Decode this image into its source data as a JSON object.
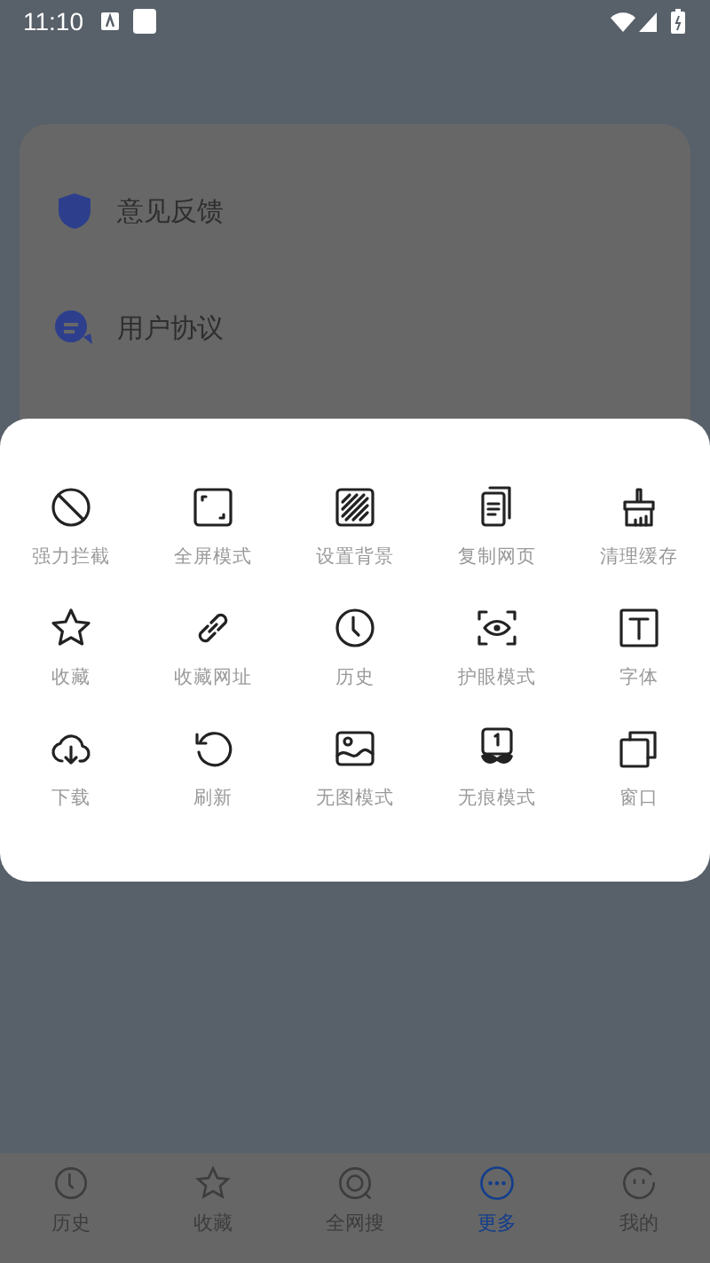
{
  "status_bar": {
    "time": "11:10"
  },
  "menu": [
    {
      "label": "意见反馈"
    },
    {
      "label": "用户协议"
    }
  ],
  "sheet": {
    "actions": [
      {
        "label": "强力拦截"
      },
      {
        "label": "全屏模式"
      },
      {
        "label": "设置背景"
      },
      {
        "label": "复制网页"
      },
      {
        "label": "清理缓存"
      },
      {
        "label": "收藏"
      },
      {
        "label": "收藏网址"
      },
      {
        "label": "历史"
      },
      {
        "label": "护眼模式"
      },
      {
        "label": "字体"
      },
      {
        "label": "下载"
      },
      {
        "label": "刷新"
      },
      {
        "label": "无图模式"
      },
      {
        "label": "无痕模式"
      },
      {
        "label": "窗口"
      }
    ]
  },
  "bottom_nav": [
    {
      "label": "历史",
      "selected": false
    },
    {
      "label": "收藏",
      "selected": false
    },
    {
      "label": "全网搜",
      "selected": false
    },
    {
      "label": "更多",
      "selected": true
    },
    {
      "label": "我的",
      "selected": false
    }
  ]
}
